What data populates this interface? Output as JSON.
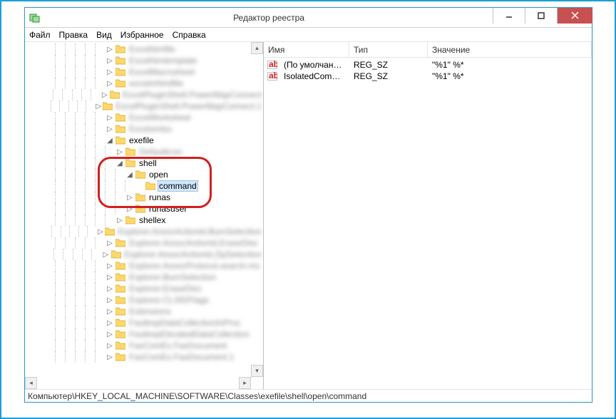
{
  "window": {
    "title": "Редактор реестра"
  },
  "menu": {
    "file": "Файл",
    "edit": "Правка",
    "view": "Вид",
    "favorites": "Избранное",
    "help": "Справка"
  },
  "tree": {
    "blurred_before": [
      "Excelhtmfile",
      "Excelhtmtemplate",
      "ExcelMacrosheet",
      "excelmhtmlfile",
      "ExcelPluginShell.PowerMapConnect",
      "ExcelPluginShell.PowerMapConnect.1",
      "ExcelWorksheet",
      "Excelxmlss"
    ],
    "exefile": "exefile",
    "exefile_child_blur": "DefaultIcon",
    "shell": "shell",
    "open": "open",
    "command": "command",
    "runas": "runas",
    "runasuser": "runasuser",
    "shellex": "shellex",
    "blurred_after": [
      "Explorer.AssocActionId.BurnSelection",
      "Explorer.AssocActionId.EraseDisc",
      "Explorer.AssocActionId.ZipSelection",
      "Explorer.AssocProtocol.search-ms",
      "Explorer.BurnSelection",
      "Explorer.EraseDisc",
      "Explorer.CLSIDFlags",
      "Extensions",
      "FaultrepDataCollectionInProc",
      "FaultrepElevatedDataCollection",
      "FaxComEx.FaxDocument",
      "FaxComEx.FaxDocument.1"
    ]
  },
  "list": {
    "headers": {
      "name": "Имя",
      "type": "Тип",
      "value": "Значение"
    },
    "rows": [
      {
        "name": "(По умолчанию)",
        "type": "REG_SZ",
        "value": "\"%1\" %*"
      },
      {
        "name": "IsolatedComma...",
        "type": "REG_SZ",
        "value": "\"%1\" %*"
      }
    ]
  },
  "statusbar": {
    "path": "Компьютер\\HKEY_LOCAL_MACHINE\\SOFTWARE\\Classes\\exefile\\shell\\open\\command"
  }
}
